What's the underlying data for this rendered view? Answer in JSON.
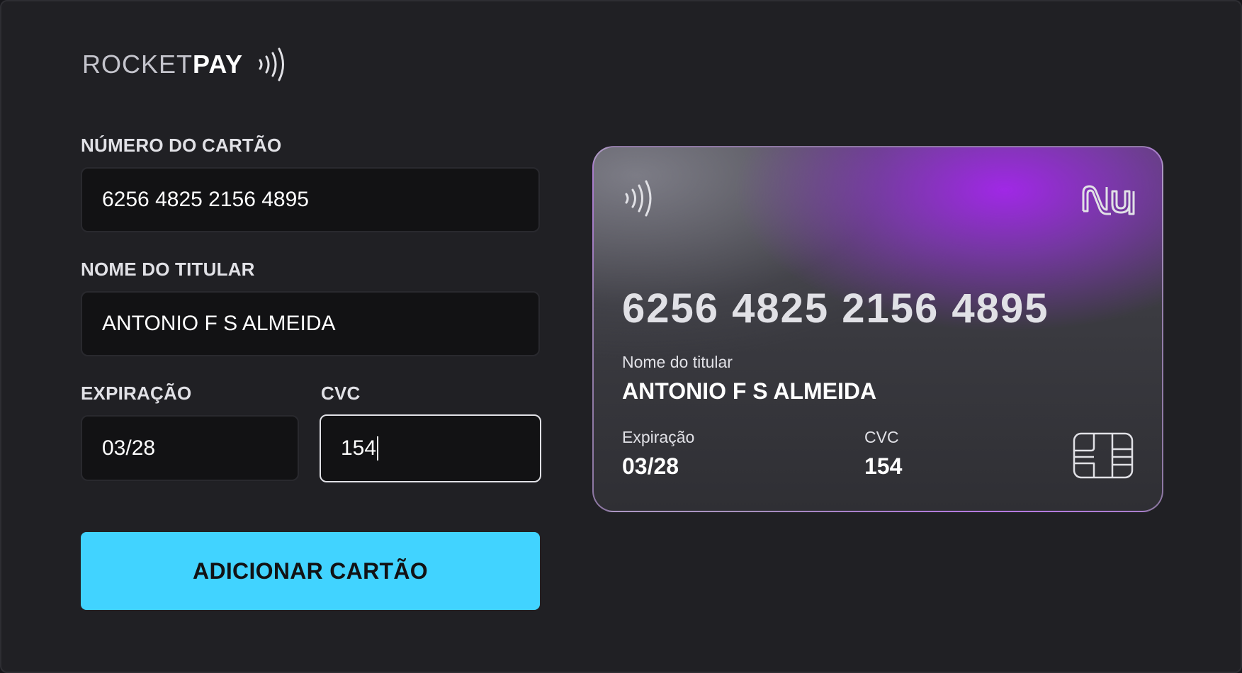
{
  "logo": {
    "rocket": "ROCKET",
    "pay": "PAY"
  },
  "form": {
    "card_number": {
      "label": "NÚMERO DO CARTÃO",
      "value": "6256 4825 2156 4895"
    },
    "holder_name": {
      "label": "NOME DO TITULAR",
      "value": "ANTONIO F S ALMEIDA"
    },
    "expiration": {
      "label": "EXPIRAÇÃO",
      "value": "03/28"
    },
    "cvc": {
      "label": "CVC",
      "value": "154"
    },
    "submit_label": "ADICIONAR CARTÃO"
  },
  "card": {
    "brand_icon": "nubank-logo",
    "number": "6256 4825 2156 4895",
    "holder_caption": "Nome do titular",
    "holder_name": "ANTONIO F S ALMEIDA",
    "expiration_caption": "Expiração",
    "expiration": "03/28",
    "cvc_caption": "CVC",
    "cvc": "154"
  },
  "colors": {
    "background": "#202024",
    "input_bg": "#121214",
    "accent_button": "#41d3ff",
    "card_purple": "#a028e6"
  }
}
